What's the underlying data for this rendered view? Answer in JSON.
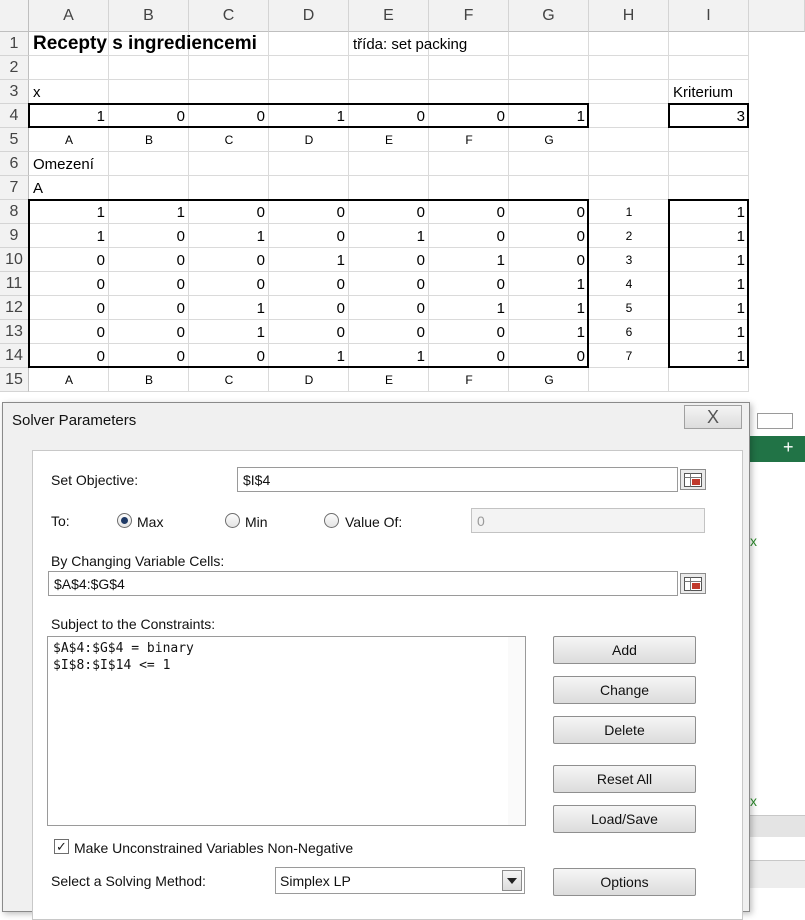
{
  "sheet": {
    "columns": [
      "A",
      "B",
      "C",
      "D",
      "E",
      "F",
      "G",
      "H",
      "I"
    ],
    "rows": [
      "1",
      "2",
      "3",
      "4",
      "5",
      "6",
      "7",
      "8",
      "9",
      "10",
      "11",
      "12",
      "13",
      "14",
      "15"
    ],
    "title": "Recepty s ingrediencemi",
    "class_note": "třída: set packing",
    "x_label": "x",
    "criterion_label": "Kriterium",
    "x_values": [
      "1",
      "0",
      "0",
      "1",
      "0",
      "0",
      "1"
    ],
    "criterion_value": "3",
    "letters_row5": [
      "A",
      "B",
      "C",
      "D",
      "E",
      "F",
      "G"
    ],
    "constraints_label": "Omezení",
    "matrix_label": "A",
    "matrix": [
      [
        "1",
        "1",
        "0",
        "0",
        "0",
        "0",
        "0"
      ],
      [
        "1",
        "0",
        "1",
        "0",
        "1",
        "0",
        "0"
      ],
      [
        "0",
        "0",
        "0",
        "1",
        "0",
        "1",
        "0"
      ],
      [
        "0",
        "0",
        "0",
        "0",
        "0",
        "0",
        "1"
      ],
      [
        "0",
        "0",
        "1",
        "0",
        "0",
        "1",
        "1"
      ],
      [
        "0",
        "0",
        "1",
        "0",
        "0",
        "0",
        "1"
      ],
      [
        "0",
        "0",
        "0",
        "1",
        "1",
        "0",
        "0"
      ]
    ],
    "row_index": [
      "1",
      "2",
      "3",
      "4",
      "5",
      "6",
      "7"
    ],
    "row_sums": [
      "1",
      "1",
      "1",
      "1",
      "1",
      "1",
      "1"
    ],
    "letters_row15": [
      "A",
      "B",
      "C",
      "D",
      "E",
      "F",
      "G"
    ]
  },
  "background": {
    "mark1": "x",
    "mark2": "x",
    "plus": "+"
  },
  "dialog": {
    "title": "Solver Parameters",
    "close_glyph": "X",
    "set_objective_label": "Set Objective:",
    "objective_value": "$I$4",
    "to_label": "To:",
    "option_max": "Max",
    "option_min": "Min",
    "option_value_of": "Value Of:",
    "value_of_input": "0",
    "changing_cells_label": "By Changing Variable Cells:",
    "changing_cells_value": "$A$4:$G$4",
    "constraints_label": "Subject to the Constraints:",
    "constraints": [
      "$A$4:$G$4 = binary",
      "$I$8:$I$14 <= 1"
    ],
    "buttons": {
      "add": "Add",
      "change": "Change",
      "delete": "Delete",
      "reset_all": "Reset All",
      "load_save": "Load/Save",
      "options": "Options"
    },
    "nonneg_label": "Make Unconstrained Variables Non-Negative",
    "nonneg_checked": true,
    "method_label": "Select a Solving Method:",
    "method_value": "Simplex LP",
    "selected_target": "Max"
  }
}
